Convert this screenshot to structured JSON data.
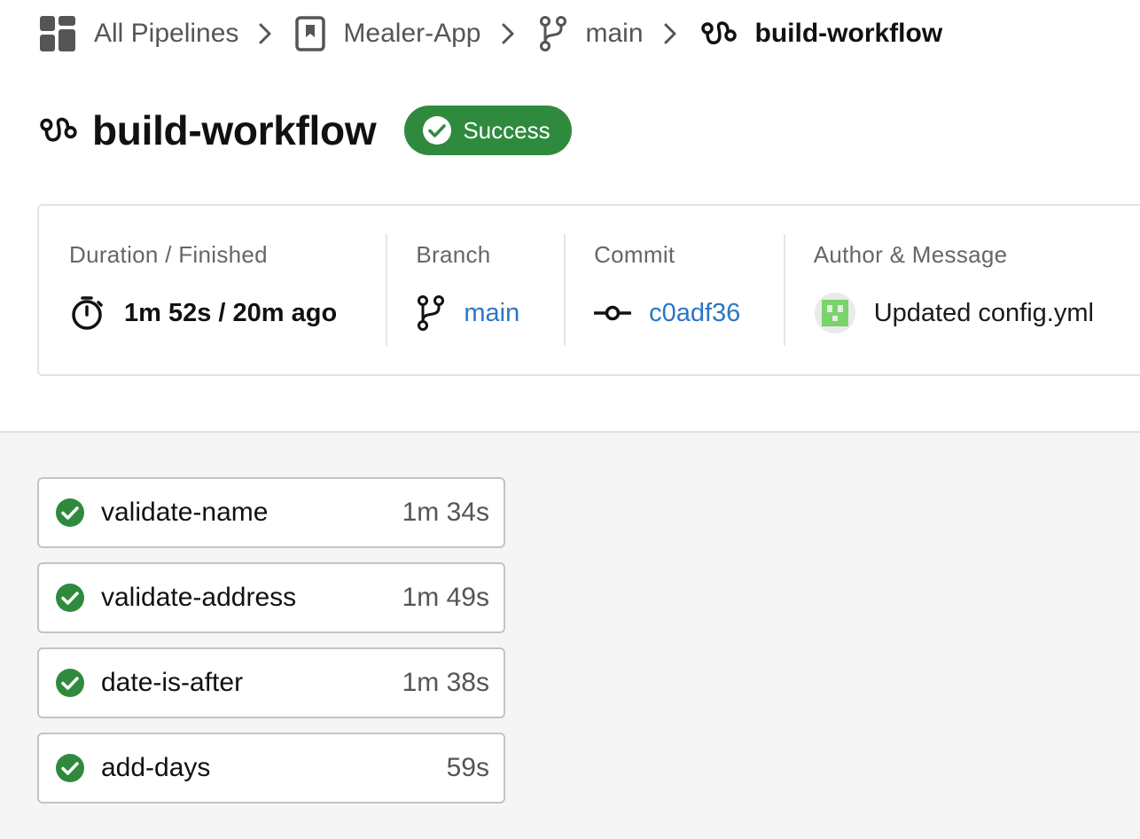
{
  "breadcrumb": {
    "items": [
      {
        "label": "All Pipelines",
        "icon": "dashboard-grid-icon"
      },
      {
        "label": "Mealer-App",
        "icon": "project-bookmark-icon"
      },
      {
        "label": "main",
        "icon": "git-branch-icon"
      },
      {
        "label": "build-workflow",
        "icon": "workflow-icon"
      }
    ],
    "separator_icon": "chevron-right-icon"
  },
  "header": {
    "title": "build-workflow",
    "icon": "workflow-icon",
    "status": {
      "label": "Success",
      "icon": "check-circle-icon",
      "color": "#2f8a3e"
    }
  },
  "details": {
    "duration": {
      "label": "Duration / Finished",
      "value": "1m 52s / 20m ago",
      "icon": "stopwatch-icon"
    },
    "branch": {
      "label": "Branch",
      "value": "main",
      "icon": "git-branch-icon"
    },
    "commit": {
      "label": "Commit",
      "value": "c0adf36",
      "icon": "git-commit-icon"
    },
    "author": {
      "label": "Author & Message",
      "value": "Updated config.yml",
      "icon": "author-avatar"
    }
  },
  "jobs": [
    {
      "name": "validate-name",
      "duration": "1m 34s",
      "status": "success"
    },
    {
      "name": "validate-address",
      "duration": "1m 49s",
      "status": "success"
    },
    {
      "name": "date-is-after",
      "duration": "1m 38s",
      "status": "success"
    },
    {
      "name": "add-days",
      "duration": "59s",
      "status": "success"
    }
  ],
  "colors": {
    "success": "#2f8a3e",
    "link": "#2b76c6",
    "avatar": "#7ad36b"
  }
}
